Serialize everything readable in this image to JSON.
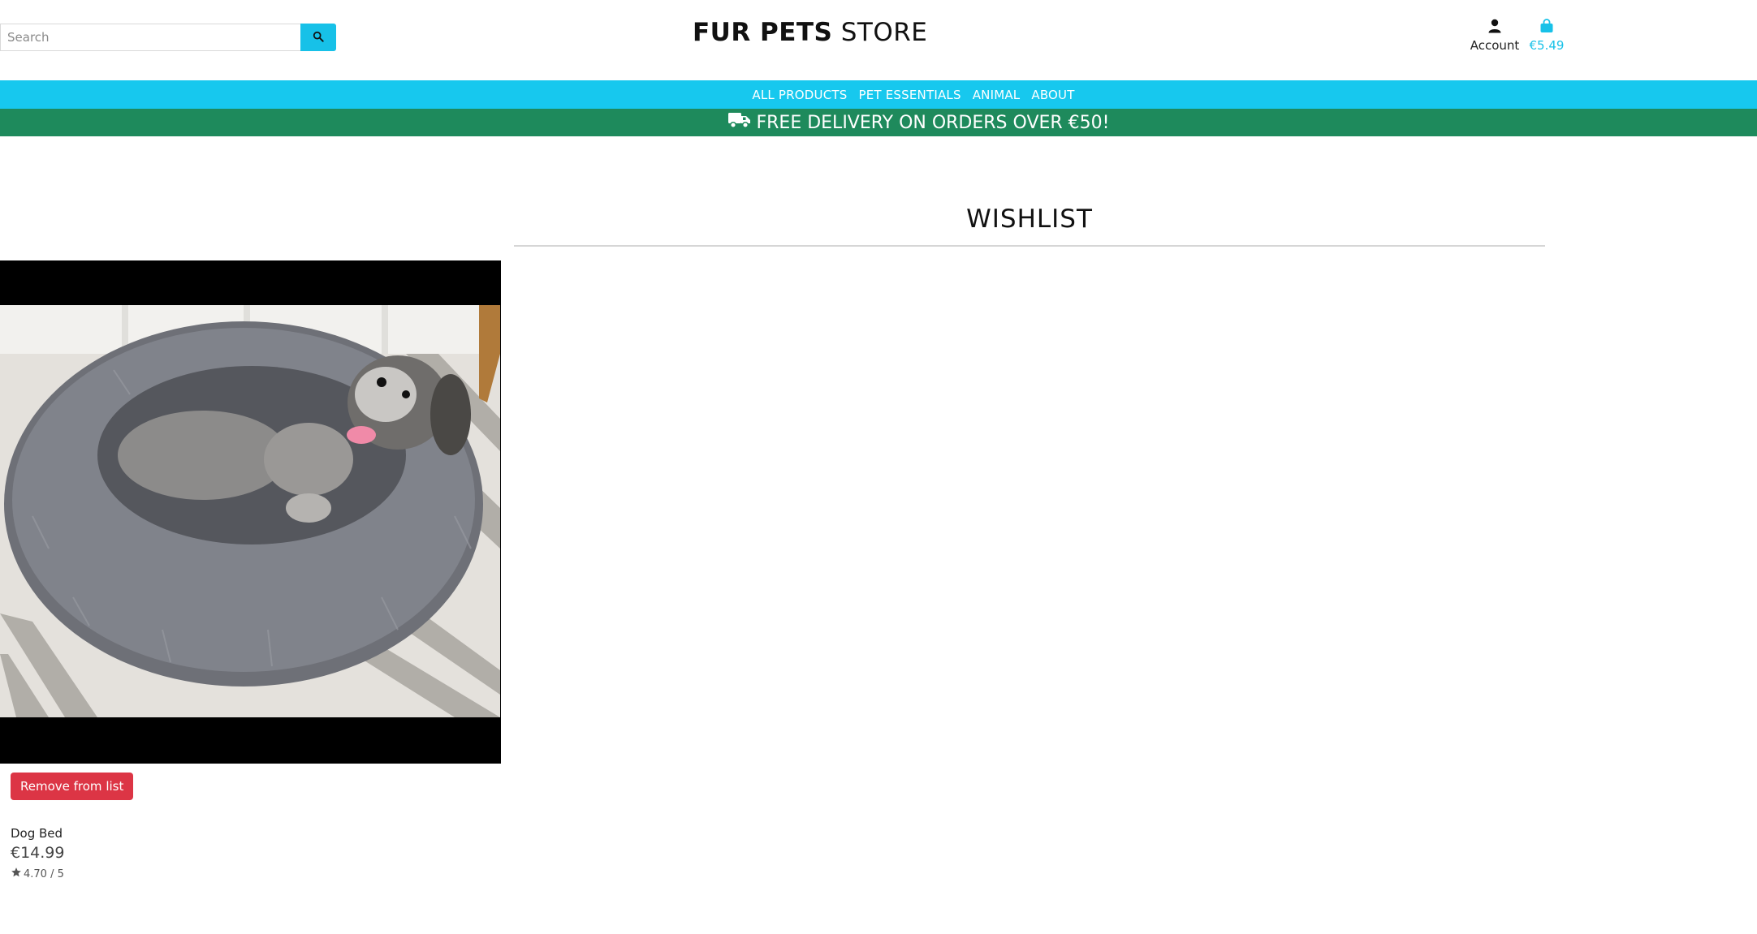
{
  "header": {
    "search_placeholder": "Search",
    "brand_bold": "FUR PETS",
    "brand_light": "STORE",
    "account_label": "Account",
    "bag_total": "€5.49"
  },
  "nav": {
    "items": [
      "ALL PRODUCTS",
      "PET ESSENTIALS",
      "ANIMAL",
      "ABOUT"
    ]
  },
  "banner": {
    "text": "FREE DELIVERY ON ORDERS OVER €50!",
    "icon": "truck-icon"
  },
  "page": {
    "title": "WISHLIST"
  },
  "wishlist": {
    "items": [
      {
        "name": "Dog Bed",
        "price": "€14.99",
        "rating": "4.70 / 5",
        "remove_label": "Remove from list",
        "image": "dog-bed-photo"
      }
    ]
  },
  "colors": {
    "accent": "#17c8ee",
    "banner": "#1e8a5c",
    "danger": "#dc3545"
  }
}
